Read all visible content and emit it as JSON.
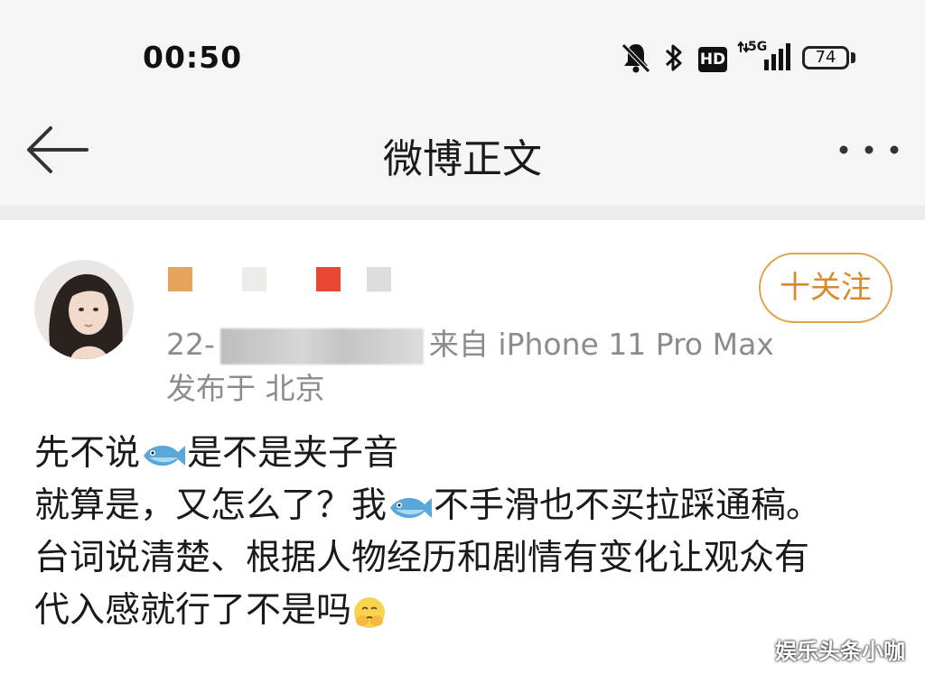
{
  "status_bar": {
    "time": "00:50",
    "network_label": "5G",
    "hd_label": "HD",
    "battery_level": "74"
  },
  "nav": {
    "title": "微博正文",
    "back_icon": "arrow-left-icon",
    "more_icon": "more-horizontal-icon"
  },
  "post": {
    "meta_prefix": "22-",
    "meta_source": "来自 iPhone 11 Pro Max",
    "location": "发布于 北京",
    "follow_label": "十关注",
    "lines": {
      "l1_a": "先不说",
      "l1_b": "是不是夹子音",
      "l2_a": "就算是，又怎么了？我",
      "l2_b": "不手滑也不买拉踩通稿。",
      "l3": "台词说清楚、根据人物经历和剧情有变化让观众有",
      "l4": "代入感就行了不是吗"
    },
    "emoji_fish": "fish-emoji",
    "emoji_face": "face-hands-emoji"
  },
  "watermark": "娱乐头条小咖",
  "colors": {
    "accent": "#e2a24a",
    "follow_text": "#d98a2a",
    "meta_gray": "#8c8c8c",
    "bar_bg": "#f5f5f5"
  }
}
